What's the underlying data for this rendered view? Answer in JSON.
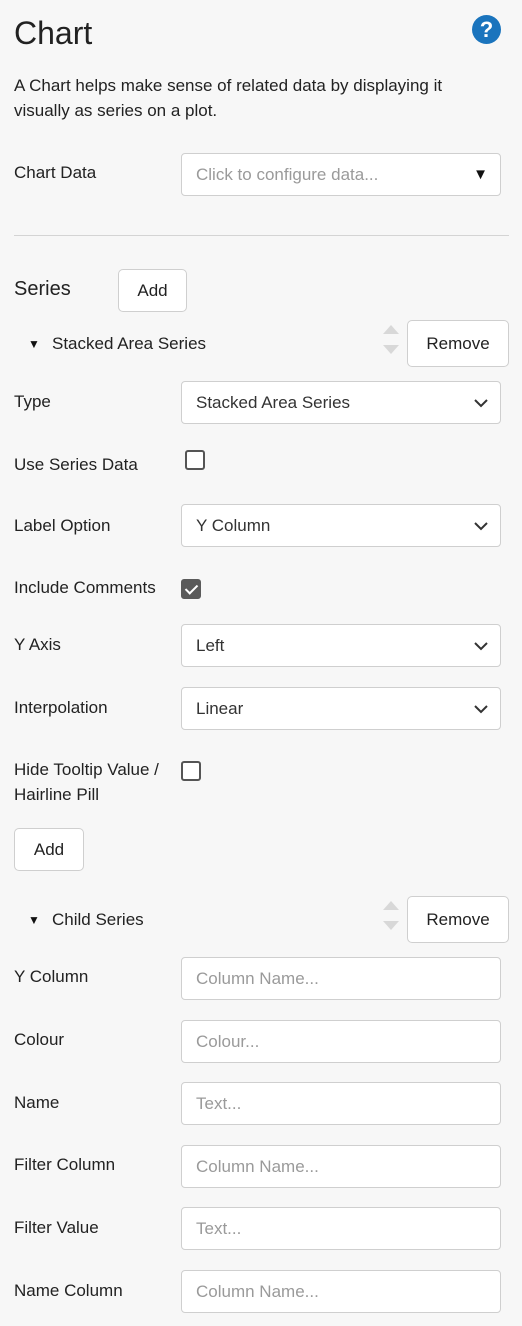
{
  "header": {
    "title": "Chart",
    "help_icon": "?"
  },
  "description": "A Chart helps make sense of related data by displaying it visually as series on a plot.",
  "chart_data": {
    "label": "Chart Data",
    "placeholder": "Click to configure data..."
  },
  "series": {
    "label": "Series",
    "add_label": "Add",
    "item": {
      "title": "Stacked Area Series",
      "remove_label": "Remove",
      "fields": {
        "type": {
          "label": "Type",
          "value": "Stacked Area Series"
        },
        "use_series_data": {
          "label": "Use Series Data",
          "checked": false
        },
        "label_option": {
          "label": "Label Option",
          "value": "Y Column"
        },
        "include_comments": {
          "label": "Include Comments",
          "checked": true
        },
        "y_axis": {
          "label": "Y Axis",
          "value": "Left"
        },
        "interpolation": {
          "label": "Interpolation",
          "value": "Linear"
        },
        "hide_tooltip": {
          "label_line1": "Hide Tooltip Value /",
          "label_line2": "Hairline Pill",
          "checked": false
        }
      },
      "child_add_label": "Add",
      "child": {
        "title": "Child Series",
        "remove_label": "Remove",
        "fields": {
          "y_column": {
            "label": "Y Column",
            "placeholder": "Column Name..."
          },
          "colour": {
            "label": "Colour",
            "placeholder": "Colour..."
          },
          "name": {
            "label": "Name",
            "placeholder": "Text..."
          },
          "filter_column": {
            "label": "Filter Column",
            "placeholder": "Column Name..."
          },
          "filter_value": {
            "label": "Filter Value",
            "placeholder": "Text..."
          },
          "name_column": {
            "label": "Name Column",
            "placeholder": "Column Name..."
          }
        }
      }
    }
  }
}
